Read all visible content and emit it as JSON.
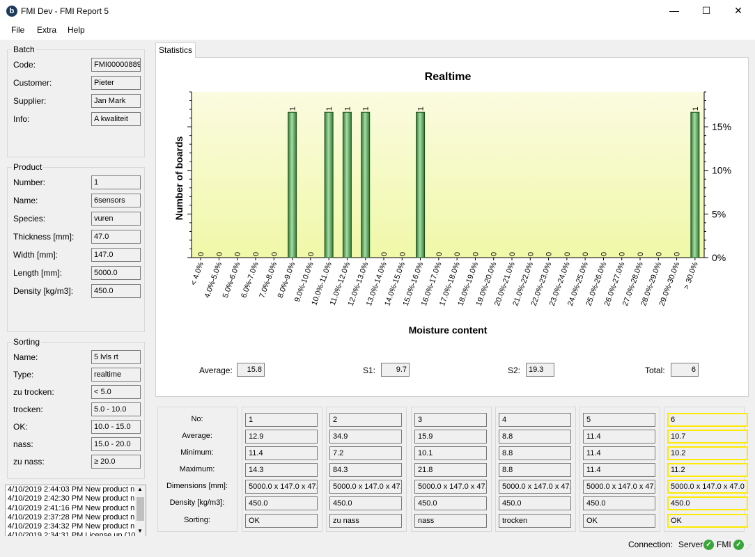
{
  "window": {
    "title": "FMI Dev - FMI Report 5",
    "icon_letter": "b",
    "minimize": "—",
    "maximize": "☐",
    "close": "✕"
  },
  "menu": [
    "File",
    "Extra",
    "Help"
  ],
  "batch": {
    "legend": "Batch",
    "fields": [
      {
        "label": "Code:",
        "value": "FMI00000889"
      },
      {
        "label": "Customer:",
        "value": "Pieter"
      },
      {
        "label": "Supplier:",
        "value": "Jan Mark"
      },
      {
        "label": "Info:",
        "value": "A kwaliteit"
      }
    ]
  },
  "product": {
    "legend": "Product",
    "fields": [
      {
        "label": "Number:",
        "value": "1"
      },
      {
        "label": "Name:",
        "value": "6sensors"
      },
      {
        "label": "Species:",
        "value": "vuren"
      },
      {
        "label": "Thickness [mm]:",
        "value": "47.0"
      },
      {
        "label": "Width [mm]:",
        "value": "147.0"
      },
      {
        "label": "Length [mm]:",
        "value": "5000.0"
      },
      {
        "label": "Density [kg/m3]:",
        "value": "450.0"
      }
    ]
  },
  "sorting": {
    "legend": "Sorting",
    "fields": [
      {
        "label": "Name:",
        "value": "5 lvls rt"
      },
      {
        "label": "Type:",
        "value": "realtime"
      },
      {
        "label": "zu trocken:",
        "value": "< 5.0"
      },
      {
        "label": "trocken:",
        "value": "5.0 - 10.0"
      },
      {
        "label": "OK:",
        "value": "10.0 - 15.0"
      },
      {
        "label": "nass:",
        "value": "15.0 - 20.0"
      },
      {
        "label": "zu nass:",
        "value": "≥ 20.0"
      }
    ]
  },
  "log": [
    "4/10/2019 2:44:03 PM New product n",
    "4/10/2019 2:42:30 PM New product n",
    "4/10/2019 2:41:16 PM New product n",
    "4/10/2019 2:37:28 PM New product n",
    "4/10/2019 2:34:32 PM New product n",
    "4/10/2019 2:34:31 PM License up (10"
  ],
  "tab": {
    "label": "Statistics"
  },
  "chart_data": {
    "type": "bar",
    "title": "Realtime",
    "xlabel": "Moisture content",
    "ylabel": "Number of boards",
    "categories": [
      "< 4.0%",
      "4.0%-5.0%",
      "5.0%-6.0%",
      "6.0%-7.0%",
      "7.0%-8.0%",
      "8.0%-9.0%",
      "9.0%-10.0%",
      "10.0%-11.0%",
      "11.0%-12.0%",
      "12.0%-13.0%",
      "13.0%-14.0%",
      "14.0%-15.0%",
      "15.0%-16.0%",
      "16.0%-17.0%",
      "17.0%-18.0%",
      "18.0%-19.0%",
      "19.0%-20.0%",
      "20.0%-21.0%",
      "21.0%-22.0%",
      "22.0%-23.0%",
      "23.0%-24.0%",
      "24.0%-25.0%",
      "25.0%-26.0%",
      "26.0%-27.0%",
      "27.0%-28.0%",
      "28.0%-29.0%",
      "29.0%-30.0%",
      "> 30.0%"
    ],
    "values": [
      0,
      0,
      0,
      0,
      0,
      1,
      0,
      1,
      1,
      1,
      0,
      0,
      1,
      0,
      0,
      0,
      0,
      0,
      0,
      0,
      0,
      0,
      0,
      0,
      0,
      0,
      0,
      1
    ],
    "percent_ticks": [
      "0%",
      "5%",
      "10%",
      "15%"
    ],
    "y_percent_range": [
      0,
      19
    ],
    "grid": false,
    "bar_color": "#4c9a4c",
    "background_gradient": [
      "#fbfbe0",
      "#f0f8a8"
    ]
  },
  "stats": [
    {
      "label": "Average:",
      "value": "15.8"
    },
    {
      "label": "S1:",
      "value": "9.7"
    },
    {
      "label": "S2:",
      "value": "19.3"
    },
    {
      "label": "Total:",
      "value": "6"
    }
  ],
  "sensor_table": {
    "row_labels": [
      "No:",
      "Average:",
      "Minimum:",
      "Maximum:",
      "Dimensions [mm]:",
      "Density [kg/m3]:",
      "Sorting:"
    ],
    "columns": [
      {
        "values": [
          "1",
          "12.9",
          "11.4",
          "14.3",
          "5000.0 x 147.0 x 47.",
          "450.0",
          "OK"
        ],
        "highlight": false
      },
      {
        "values": [
          "2",
          "34.9",
          "7.2",
          "84.3",
          "5000.0 x 147.0 x 47.",
          "450.0",
          "zu nass"
        ],
        "highlight": false
      },
      {
        "values": [
          "3",
          "15.9",
          "10.1",
          "21.8",
          "5000.0 x 147.0 x 47.",
          "450.0",
          "nass"
        ],
        "highlight": false
      },
      {
        "values": [
          "4",
          "8.8",
          "8.8",
          "8.8",
          "5000.0 x 147.0 x 47.",
          "450.0",
          "trocken"
        ],
        "highlight": false
      },
      {
        "values": [
          "5",
          "11.4",
          "11.4",
          "11.4",
          "5000.0 x 147.0 x 47.",
          "450.0",
          "OK"
        ],
        "highlight": false
      },
      {
        "values": [
          "6",
          "10.7",
          "10.2",
          "11.2",
          "5000.0 x 147.0 x 47.0",
          "450.0",
          "OK"
        ],
        "highlight": true
      }
    ],
    "highlight_color": "#ffea00"
  },
  "status": {
    "connection_label": "Connection:",
    "server_label": "Server",
    "fmi_label": "FMI",
    "ok_glyph": "✓"
  }
}
